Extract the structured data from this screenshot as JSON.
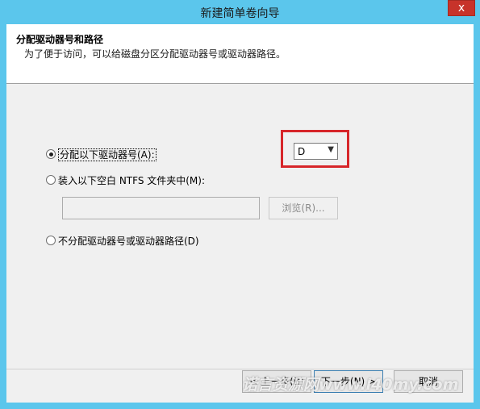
{
  "window": {
    "title": "新建简单卷向导",
    "close_glyph": "x"
  },
  "header": {
    "title": "分配驱动器号和路径",
    "subtitle": "为了便于访问，可以给磁盘分区分配驱动器号或驱动器路径。"
  },
  "options": {
    "assign_letter_label": "分配以下驱动器号(A):",
    "mount_folder_label": "装入以下空白 NTFS 文件夹中(M):",
    "no_assign_label": "不分配驱动器号或驱动器路径(D)",
    "selected": "assign_letter"
  },
  "drive_letter": {
    "value": "D"
  },
  "folder_path": {
    "value": "",
    "browse_label": "浏览(R)..."
  },
  "footer": {
    "back_label": "< 上一步(B)",
    "next_label": "下一步(N) >",
    "cancel_label": "取消"
  },
  "watermark": "诺言资源网www.l40my.com",
  "colors": {
    "titlebar": "#5bc6ec",
    "close": "#c7332a",
    "highlight_box": "#d7262a",
    "panel": "#f0f0f0"
  }
}
